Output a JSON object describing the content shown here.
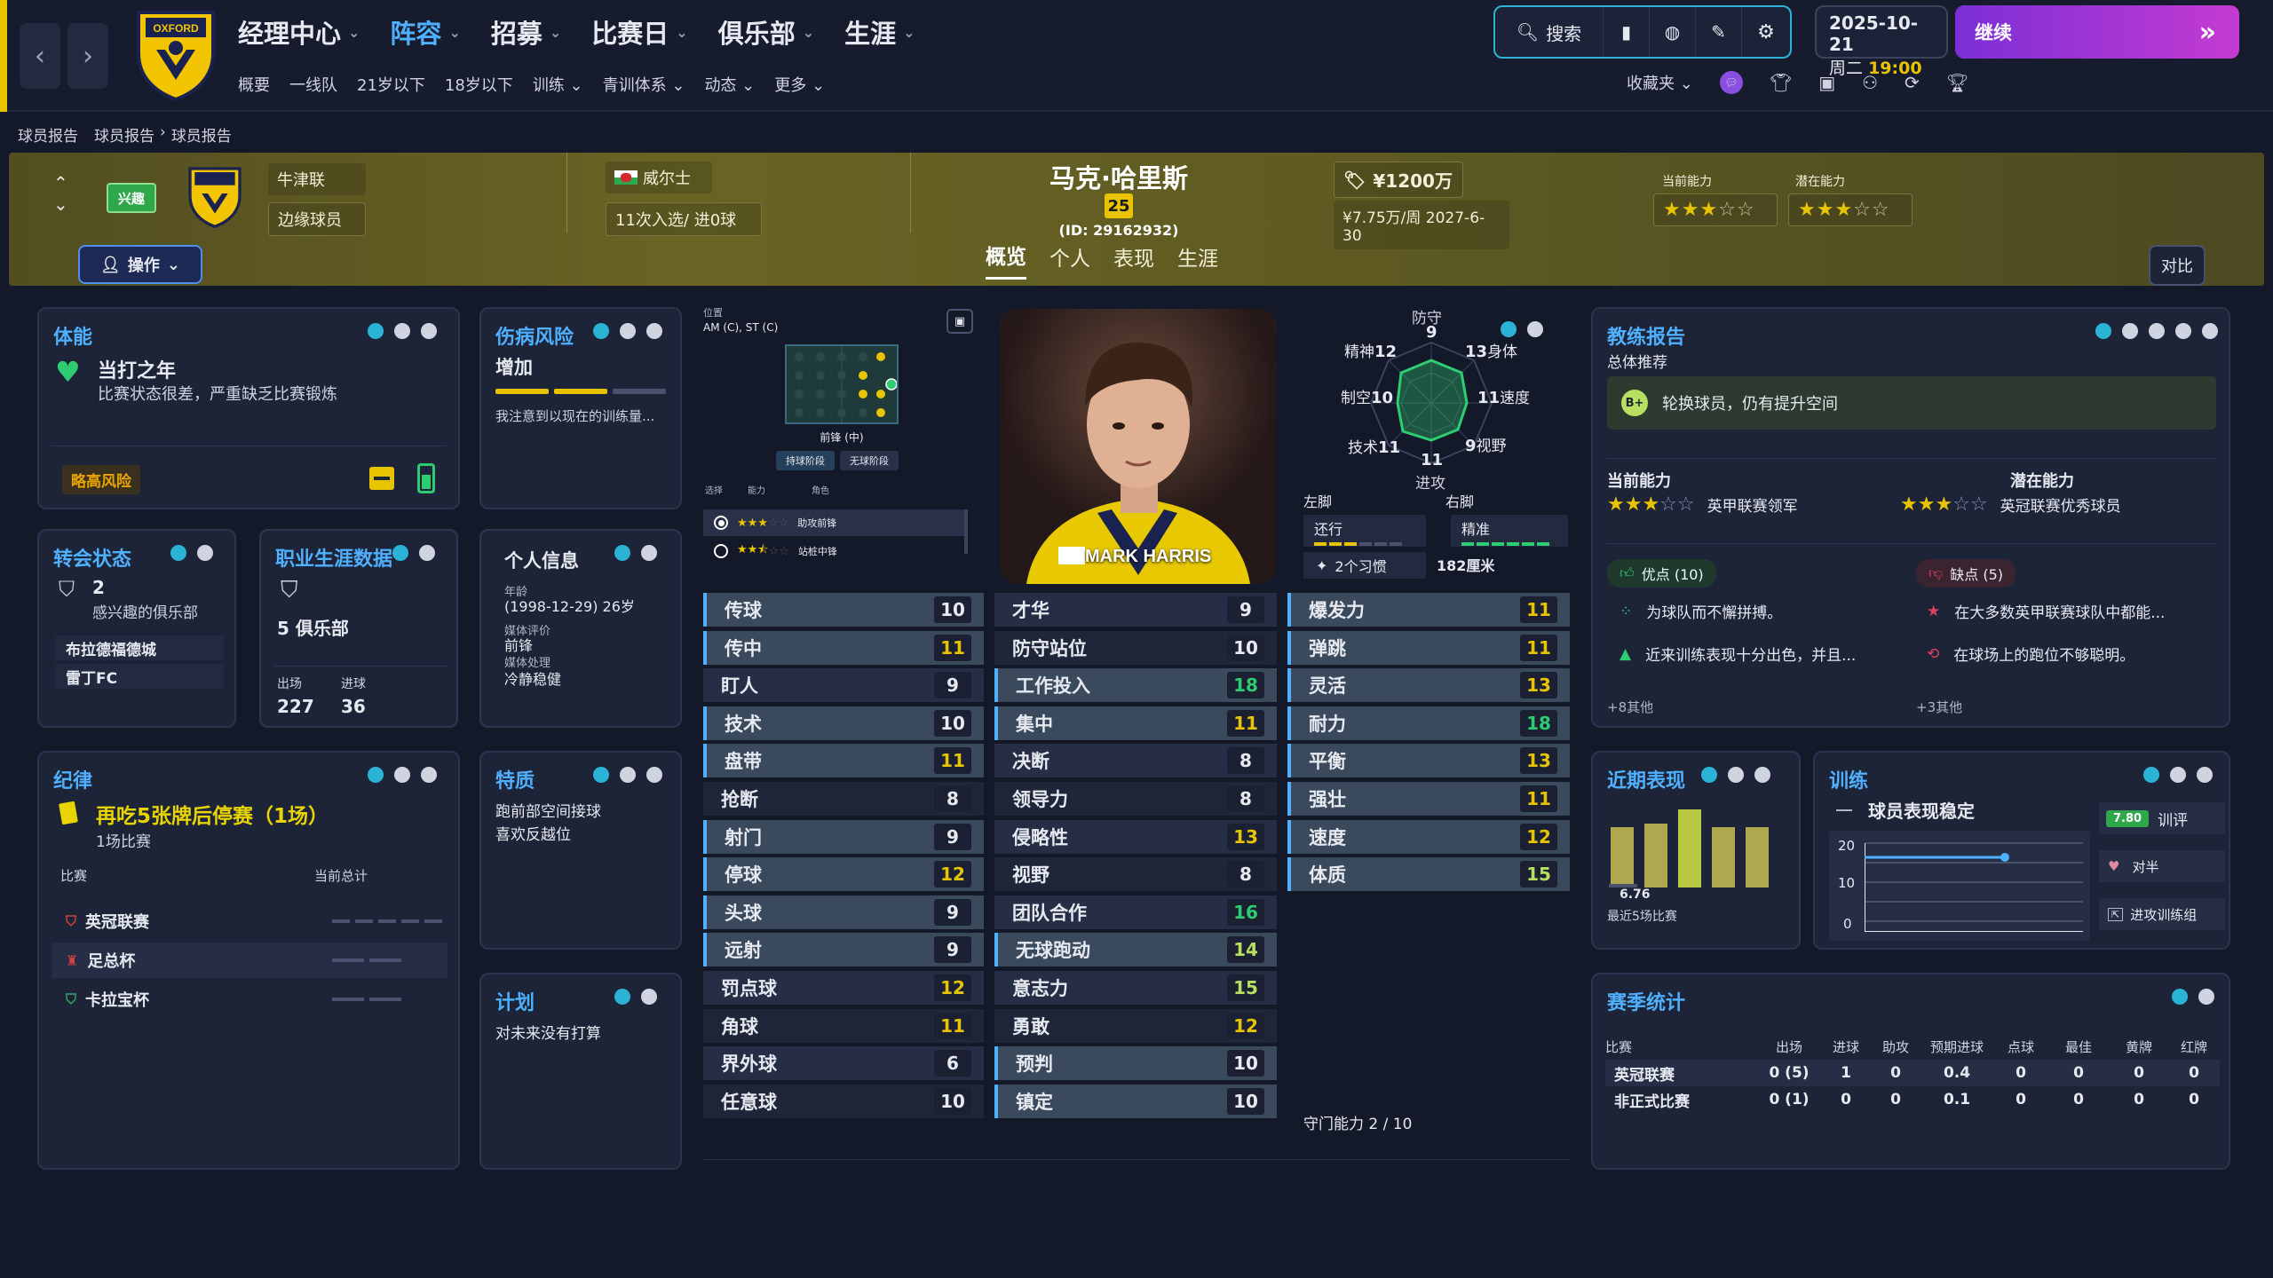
{
  "nav": {
    "main": [
      {
        "label": "经理中心"
      },
      {
        "label": "阵容"
      },
      {
        "label": "招募"
      },
      {
        "label": "比赛日"
      },
      {
        "label": "俱乐部"
      },
      {
        "label": "生涯"
      }
    ],
    "sub": [
      "概要",
      "一线队",
      "21岁以下",
      "18岁以下",
      "训练",
      "青训体系",
      "动态",
      "更多"
    ],
    "search_label": "搜索",
    "date": "2025-10-21",
    "weekday": "周二",
    "time": "19:00",
    "continue_label": "继续",
    "favorites_label": "收藏夹"
  },
  "breadcrumb": [
    "球员报告",
    "球员报告",
    "球员报告"
  ],
  "player": {
    "name": "马克·哈里斯",
    "number": "25",
    "id": "(ID: 29162932)",
    "status_badge": "兴趣",
    "club": "牛津联",
    "role": "边缘球员",
    "nationality": "威尔士",
    "caps": "11次入选/ 进0球",
    "value": "¥1200万",
    "wage": "¥7.75万/周 2027-6-30",
    "ca_label": "当前能力",
    "pa_label": "潜在能力",
    "ca_stars": 3,
    "pa_stars": 3,
    "actions_label": "操作",
    "compare_label": "对比",
    "tabs": [
      "概览",
      "个人",
      "表现",
      "生涯"
    ],
    "shirt_name": "MARK HARRIS"
  },
  "fitness": {
    "title": "体能",
    "headline": "当打之年",
    "desc": "比赛状态很差，严重缺乏比赛锻炼",
    "risk": "略高风险"
  },
  "injury": {
    "title": "伤病风险",
    "level": "增加",
    "desc": "我注意到以现在的训练量..."
  },
  "transfer": {
    "title": "转会状态",
    "count": "2",
    "desc": "感兴趣的俱乐部",
    "clubs": [
      "布拉德福德城",
      "雷丁FC"
    ]
  },
  "career": {
    "title": "职业生涯数据",
    "clubs": "5 俱乐部",
    "apps_label": "出场",
    "goals_label": "进球",
    "apps": "227",
    "goals": "36"
  },
  "personal": {
    "title": "个人信息",
    "age_label": "年龄",
    "age": "(1998-12-29) 26岁",
    "media_rating_label": "媒体评价",
    "media_rating": "前锋",
    "media_handling_label": "媒体处理",
    "media_handling": "冷静稳健"
  },
  "position": {
    "label": "位置",
    "value": "AM (C), ST (C)",
    "role_name": "前锋 (中)",
    "phase_in": "持球阶段",
    "phase_out": "无球阶段",
    "col_select": "选择",
    "col_ability": "能力",
    "col_role": "角色",
    "roles": [
      {
        "name": "助攻前锋",
        "stars": 3
      },
      {
        "name": "站桩中锋",
        "stars": 2.5
      }
    ]
  },
  "discipline": {
    "title": "纪律",
    "headline": "再吃5张牌后停赛（1场）",
    "sub": "1场比赛",
    "col_comp": "比赛",
    "col_total": "当前总计",
    "comps": [
      "英冠联赛",
      "足总杯",
      "卡拉宝杯"
    ]
  },
  "traits": {
    "title": "特质",
    "items": [
      "跑前部空间接球",
      "喜欢反越位"
    ]
  },
  "plans": {
    "title": "计划",
    "text": "对未来没有打算"
  },
  "radar": {
    "labels": [
      {
        "name": "防守",
        "value": "9"
      },
      {
        "name": "身体",
        "value": "13"
      },
      {
        "name": "速度",
        "value": "11"
      },
      {
        "name": "视野",
        "value": "9"
      },
      {
        "name": "进攻",
        "value": "11"
      },
      {
        "name": "技术",
        "value": "11"
      },
      {
        "name": "制空",
        "value": "10"
      },
      {
        "name": "精神",
        "value": "12"
      }
    ],
    "left_foot_label": "左脚",
    "right_foot_label": "右脚",
    "left_foot": "还行",
    "right_foot": "精准",
    "habits": "2个习惯",
    "height": "182厘米"
  },
  "attributes": {
    "technical": [
      {
        "name": "传球",
        "value": "10"
      },
      {
        "name": "传中",
        "value": "11"
      },
      {
        "name": "盯人",
        "value": "9"
      },
      {
        "name": "技术",
        "value": "10"
      },
      {
        "name": "盘带",
        "value": "11"
      },
      {
        "name": "抢断",
        "value": "8"
      },
      {
        "name": "射门",
        "value": "9"
      },
      {
        "name": "停球",
        "value": "12"
      },
      {
        "name": "头球",
        "value": "9"
      },
      {
        "name": "远射",
        "value": "9"
      },
      {
        "name": "罚点球",
        "value": "12"
      },
      {
        "name": "角球",
        "value": "11"
      },
      {
        "name": "界外球",
        "value": "6"
      },
      {
        "name": "任意球",
        "value": "10"
      }
    ],
    "mental": [
      {
        "name": "才华",
        "value": "9"
      },
      {
        "name": "防守站位",
        "value": "10"
      },
      {
        "name": "工作投入",
        "value": "18"
      },
      {
        "name": "集中",
        "value": "11"
      },
      {
        "name": "决断",
        "value": "8"
      },
      {
        "name": "领导力",
        "value": "8"
      },
      {
        "name": "侵略性",
        "value": "13"
      },
      {
        "name": "视野",
        "value": "8"
      },
      {
        "name": "团队合作",
        "value": "16"
      },
      {
        "name": "无球跑动",
        "value": "14"
      },
      {
        "name": "意志力",
        "value": "15"
      },
      {
        "name": "勇敢",
        "value": "12"
      },
      {
        "name": "预判",
        "value": "10"
      },
      {
        "name": "镇定",
        "value": "10"
      }
    ],
    "physical": [
      {
        "name": "爆发力",
        "value": "11"
      },
      {
        "name": "弹跳",
        "value": "11"
      },
      {
        "name": "灵活",
        "value": "13"
      },
      {
        "name": "耐力",
        "value": "18"
      },
      {
        "name": "平衡",
        "value": "13"
      },
      {
        "name": "强壮",
        "value": "11"
      },
      {
        "name": "速度",
        "value": "12"
      },
      {
        "name": "体质",
        "value": "15"
      }
    ],
    "gk_ability": "守门能力 2 / 10"
  },
  "coach": {
    "title": "教练报告",
    "subtitle": "总体推荐",
    "grade": "B+",
    "recommend": "轮换球员，仍有提升空间",
    "ca_label": "当前能力",
    "pa_label": "潜在能力",
    "ca_text": "英甲联赛领军",
    "pa_text": "英冠联赛优秀球员",
    "pros_label": "优点 (10)",
    "cons_label": "缺点 (5)",
    "pros": [
      "为球队而不懈拼搏。",
      "近来训练表现十分出色，并且..."
    ],
    "cons": [
      "在大多数英甲联赛球队中都能...",
      "在球场上的跑位不够聪明。"
    ],
    "pros_more": "+8其他",
    "cons_more": "+3其他"
  },
  "recent": {
    "title": "近期表现",
    "avg": "6.76",
    "label": "最近5场比赛",
    "ratings": [
      6.7,
      6.8,
      7.2,
      6.7,
      6.7
    ]
  },
  "training": {
    "title": "训练",
    "status": "球员表现稳定",
    "rating": "7.80",
    "rating_label": "训评",
    "opponent_label": "对半",
    "unit_label": "进攻训练组",
    "y_ticks": [
      "20",
      "10",
      "0"
    ]
  },
  "season": {
    "title": "赛季统计",
    "cols": [
      "比赛",
      "出场",
      "进球",
      "助攻",
      "预期进球",
      "点球",
      "最佳",
      "黄牌",
      "红牌"
    ],
    "rows": [
      [
        "英冠联赛",
        "0 (5)",
        "1",
        "0",
        "0.4",
        "0",
        "0",
        "0",
        "0"
      ],
      [
        "非正式比赛",
        "0 (1)",
        "0",
        "0",
        "0.1",
        "0",
        "0",
        "0",
        "0"
      ]
    ]
  },
  "colors": {
    "accent": "#2bb3d6",
    "green": "#2ecc71",
    "yellow": "#e8c400",
    "purple": "#a43bd6"
  }
}
